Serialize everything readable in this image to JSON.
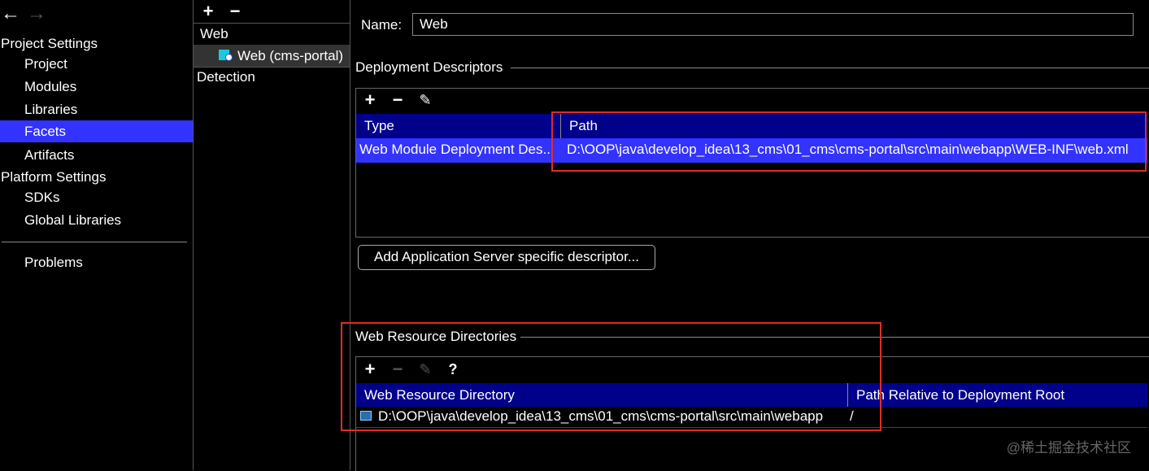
{
  "toolbar": {
    "back_icon": "arrow-left-icon",
    "forward_icon": "arrow-right-icon"
  },
  "nav": {
    "project_settings_header": "Project Settings",
    "project": "Project",
    "modules": "Modules",
    "libraries": "Libraries",
    "facets": "Facets",
    "artifacts": "Artifacts",
    "platform_settings_header": "Platform Settings",
    "sdks": "SDKs",
    "global_libraries": "Global Libraries",
    "problems": "Problems"
  },
  "facets_tree": {
    "add": "+",
    "remove": "−",
    "group_web": "Web",
    "item_web": "Web (cms-portal)",
    "detection": "Detection"
  },
  "detail": {
    "name_label": "Name:",
    "name_value": "Web",
    "deployment_descriptors_title": "Deployment Descriptors",
    "dd_table": {
      "col_type": "Type",
      "col_path": "Path",
      "row_type": "Web Module Deployment Des...",
      "row_path": "D:\\OOP\\java\\develop_idea\\13_cms\\01_cms\\cms-portal\\src\\main\\webapp\\WEB-INF\\web.xml"
    },
    "add_server_descriptor_button": "Add Application Server specific descriptor...",
    "web_resource_dirs_title": "Web Resource Directories",
    "wr_help": "?",
    "wr_table": {
      "col_dir": "Web Resource Directory",
      "col_rel": "Path Relative to Deployment Root",
      "row_dir": "D:\\OOP\\java\\develop_idea\\13_cms\\01_cms\\cms-portal\\src\\main\\webapp",
      "row_rel": "/"
    }
  },
  "watermark": "@稀土掘金技术社区",
  "colors": {
    "selection": "#3333ff",
    "header": "#00008b",
    "highlight_box": "#e02b2b"
  }
}
